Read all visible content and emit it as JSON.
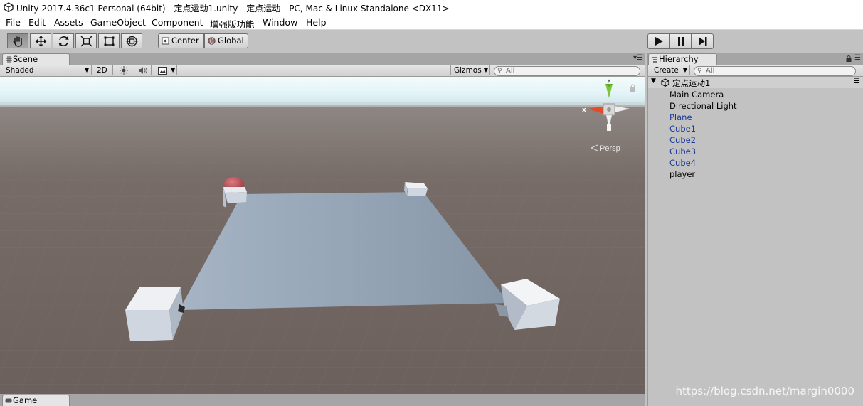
{
  "window": {
    "title": "Unity 2017.4.36c1 Personal (64bit) - 定点运动1.unity - 定点运动 - PC, Mac & Linux Standalone <DX11>"
  },
  "menu": [
    "File",
    "Edit",
    "Assets",
    "GameObject",
    "Component",
    "增强版功能",
    "Window",
    "Help"
  ],
  "toolbar": {
    "tools": [
      "hand-tool",
      "move-tool",
      "rotate-tool",
      "scale-tool",
      "rect-tool",
      "transform-tool"
    ],
    "pivot_mode": "Center",
    "pivot_rotation": "Global"
  },
  "scene": {
    "tab_label": "Scene",
    "shading_mode": "Shaded",
    "mode_2d": "2D",
    "gizmos_label": "Gizmos",
    "search_placeholder": "All",
    "projection_label": "Persp",
    "gizmo_axes": {
      "x": "x",
      "y": "y"
    }
  },
  "game": {
    "tab_label": "Game"
  },
  "hierarchy": {
    "tab_label": "Hierarchy",
    "create_label": "Create",
    "search_placeholder": "All",
    "scene_name": "定点运动1",
    "items": [
      {
        "label": "Main Camera",
        "prefab": false
      },
      {
        "label": "Directional Light",
        "prefab": false
      },
      {
        "label": "Plane",
        "prefab": true
      },
      {
        "label": "Cube1",
        "prefab": true
      },
      {
        "label": "Cube2",
        "prefab": true
      },
      {
        "label": "Cube3",
        "prefab": true
      },
      {
        "label": "Cube4",
        "prefab": true
      },
      {
        "label": "player",
        "prefab": false
      }
    ]
  },
  "watermark": "https://blog.csdn.net/margin0000",
  "colors": {
    "prefab_text": "#1a3a9a",
    "ground": "#6d625d",
    "sky": "#e6f5f8"
  }
}
